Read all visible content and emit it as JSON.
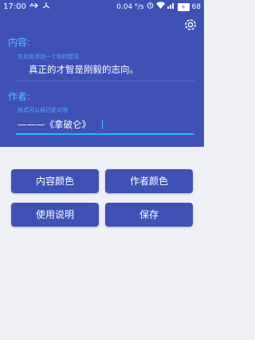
{
  "statusbar": {
    "time": "17:00",
    "usb_icon": "usb-icon",
    "network_speed": "0.04 ᴷ/s",
    "battery": "68"
  },
  "content": {
    "label": "内容:",
    "hint": "在此处添加一个你的想法",
    "value": "真正的才智是刚毅的志向。"
  },
  "author": {
    "label": "作者:",
    "hint": "格式可以自己定义哦",
    "value": "———《拿破仑》"
  },
  "buttons": {
    "content_color": "内容颜色",
    "author_color": "作者颜色",
    "instructions": "使用说明",
    "save": "保存"
  },
  "colors": {
    "header": "#3f51b5",
    "accent": "#4fc3f7",
    "button": "#3f51b5",
    "background": "#eef0f6"
  }
}
